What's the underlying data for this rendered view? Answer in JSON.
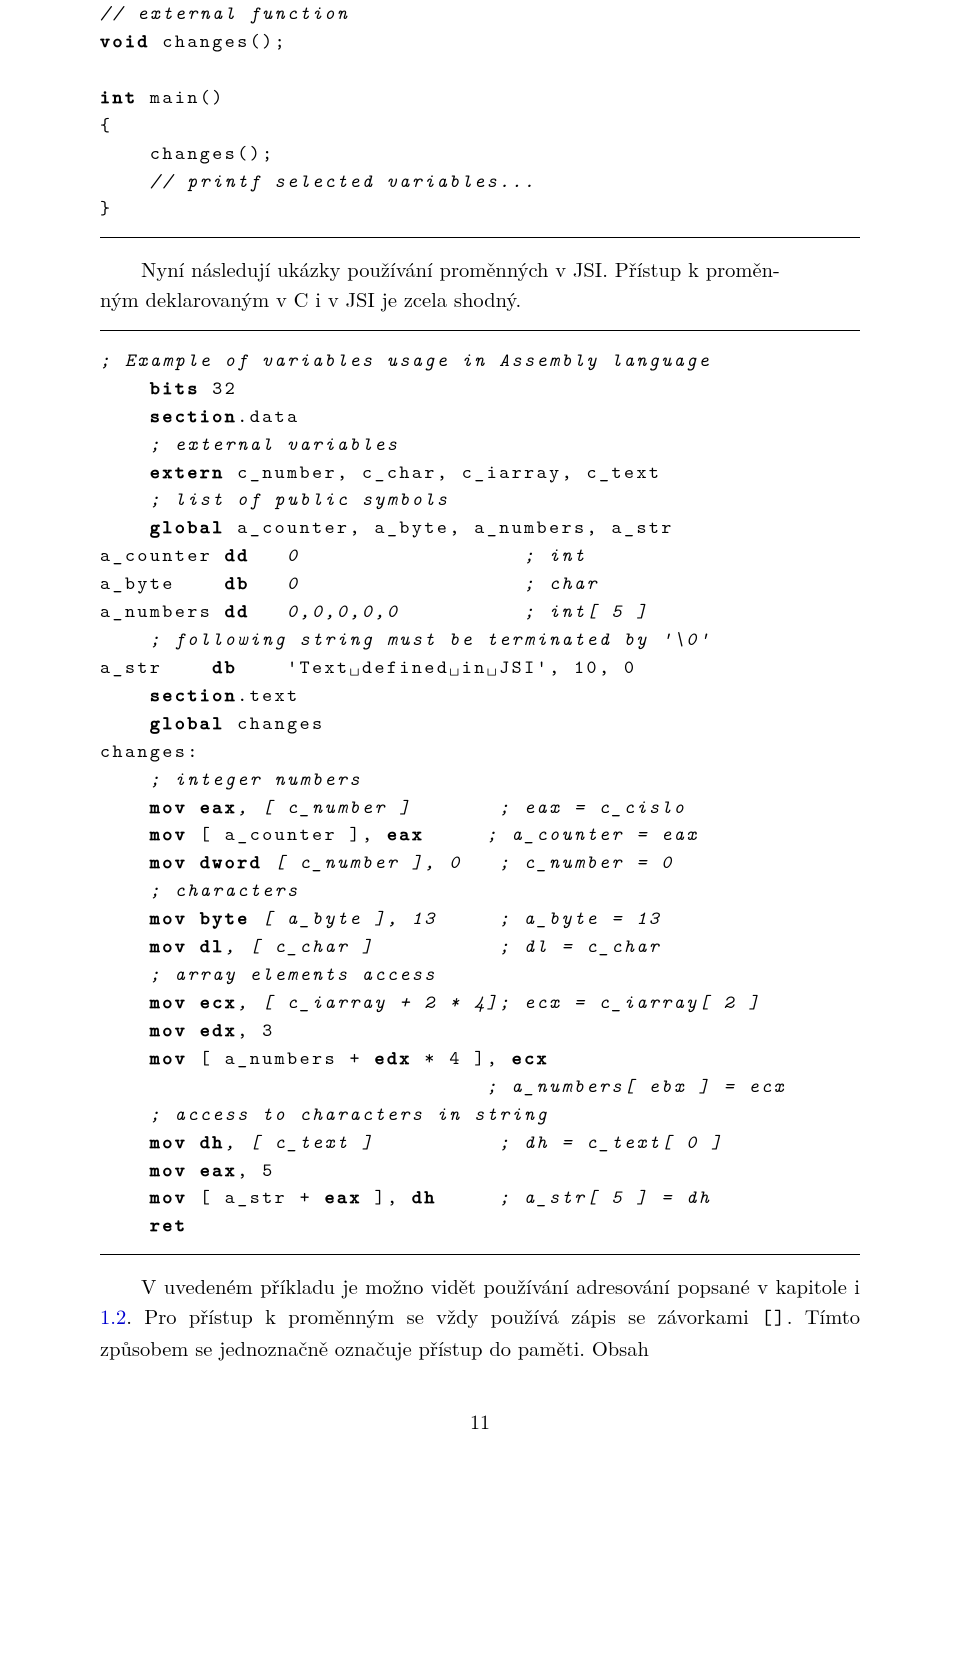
{
  "code1": {
    "l1": "// external function",
    "l2_kw": "void",
    "l2_rest": " changes();",
    "l3_blank": "",
    "l4_kw": "int",
    "l4_rest": " main()",
    "l5": "{",
    "l6": "    changes();",
    "l7": "    // printf selected variables...",
    "l8": "}"
  },
  "para1": {
    "line1": "Nyní následují ukázky používání proměnných v JSI. Přístup k proměn-",
    "line2": "ným deklarovaným v C i v JSI je zcela shodný."
  },
  "code2": {
    "l1": "; Example of variables usage in Assembly language",
    "l2a": "    ",
    "l2b_kw": "bits",
    "l2c": " 32",
    "l3a": "    ",
    "l3b_kw": "section",
    "l3c": ".data",
    "l4": "    ; external variables",
    "l5a": "    ",
    "l5b_kw": "extern",
    "l5c": " c_number, c_char, c_iarray, c_text",
    "l6": "    ; list of public symbols",
    "l7a": "    ",
    "l7b_kw": "global",
    "l7c": " a_counter, a_byte, a_numbers, a_str",
    "l8a": "a_counter ",
    "l8b_kw": "dd",
    "l8c": "   0                  ; int",
    "l9a": "a_byte    ",
    "l9b_kw": "db",
    "l9c": "   0                  ; char",
    "l10a": "a_numbers ",
    "l10b_kw": "dd",
    "l10c": "   0,0,0,0,0          ; int[ 5 ]",
    "l11": "    ; following string must be terminated by '\\0'",
    "l12a": "a_str    ",
    "l12b_kw": "db",
    "l12c": "    'Text␣defined␣in␣JSI', 10, 0",
    "l13a": "    ",
    "l13b_kw": "section",
    "l13c": ".text",
    "l14a": "    ",
    "l14b_kw": "global",
    "l14c": " changes",
    "l15": "changes:",
    "l16": "    ; integer numbers",
    "l17a": "    ",
    "l17b_kw": "mov",
    "l17c": " ",
    "l17d_kw": "eax",
    "l17e": ", [ c_number ]       ; eax = c_cislo",
    "l18a": "    ",
    "l18b_kw": "mov",
    "l18c": " [ a_counter ], ",
    "l18d_kw": "eax",
    "l18e": "     ; a_counter = eax",
    "l19a": "    ",
    "l19b_kw": "mov",
    "l19c": " ",
    "l19d_kw": "dword",
    "l19e": " [ c_number ], 0   ; c_number = 0",
    "l20": "    ; characters",
    "l21a": "    ",
    "l21b_kw": "mov",
    "l21c": " ",
    "l21d_kw": "byte",
    "l21e": " [ a_byte ], 13     ; a_byte = 13",
    "l22a": "    ",
    "l22b_kw": "mov",
    "l22c": " ",
    "l22d_kw": "dl",
    "l22e": ", [ c_char ]          ; dl = c_char",
    "l23": "    ; array elements access",
    "l24a": "    ",
    "l24b_kw": "mov",
    "l24c": " ",
    "l24d_kw": "ecx",
    "l24e": ", [ c_iarray + 2 ∗ 4]; ecx = c_iarray[ 2 ]",
    "l25a": "    ",
    "l25b_kw": "mov",
    "l25c": " ",
    "l25d_kw": "edx",
    "l25e": ", 3",
    "l26a": "    ",
    "l26b_kw": "mov",
    "l26c": " [ a_numbers + ",
    "l26d_kw": "edx",
    "l26e": " ∗ 4 ], ",
    "l26f_kw": "ecx",
    "l27": "                               ; a_numbers[ ebx ] = ecx",
    "l28": "    ; access to characters in string",
    "l29a": "    ",
    "l29b_kw": "mov",
    "l29c": " ",
    "l29d_kw": "dh",
    "l29e": ", [ c_text ]          ; dh = c_text[ 0 ]",
    "l30a": "    ",
    "l30b_kw": "mov",
    "l30c": " ",
    "l30d_kw": "eax",
    "l30e": ", 5",
    "l31a": "    ",
    "l31b_kw": "mov",
    "l31c": " [ a_str + ",
    "l31d_kw": "eax",
    "l31e": " ], ",
    "l31f_kw": "dh",
    "l31g": "     ; a_str[ 5 ] = dh",
    "l32a": "    ",
    "l32b_kw": "ret"
  },
  "para2": {
    "text1": "V uvedeném příkladu je možno vidět používání adresování popsané v kapitole i ",
    "link": "1.2",
    "text2": ". Pro přístup k proměnným se vždy používá zápis se závorkami ",
    "tt": "[]",
    "text3": ". Tímto způsobem se jednoznačně označuje přístup do paměti. Obsah"
  },
  "pagenum": "11"
}
